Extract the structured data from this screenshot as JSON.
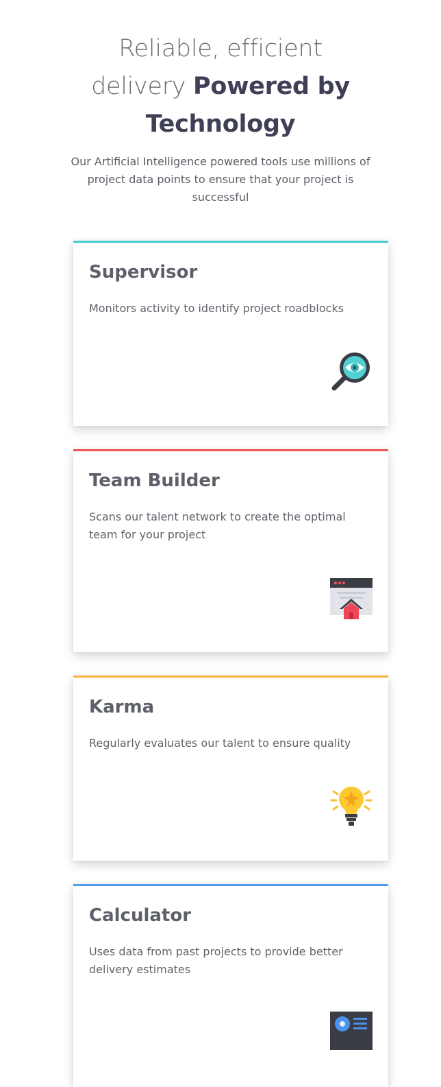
{
  "header": {
    "headline_light": "Reliable, efficient delivery",
    "headline_bold": "Powered by Technology",
    "subheadline": "Our Artificial Intelligence powered tools use millions of project data points to ensure that your project is successful"
  },
  "cards": [
    {
      "title": "Supervisor",
      "description": "Monitors activity to identify project roadblocks",
      "icon": "magnifier-eye-icon",
      "accent": "#44d0d2"
    },
    {
      "title": "Team Builder",
      "description": "Scans our talent network to create the optimal team for your project",
      "icon": "browser-window-house-icon",
      "accent": "#ea5454"
    },
    {
      "title": "Karma",
      "description": "Regularly evaluates our talent to ensure quality",
      "icon": "lightbulb-icon",
      "accent": "#fcaf41"
    },
    {
      "title": "Calculator",
      "description": "Uses data from past projects to provide better delivery estimates",
      "icon": "id-card-icon",
      "accent": "#549ef2"
    }
  ]
}
